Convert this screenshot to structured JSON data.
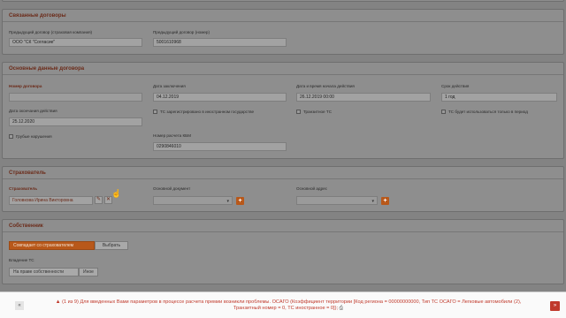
{
  "related": {
    "title": "Связанные договоры",
    "prev_insurer_label": "Предыдущий договор (страховая компания)",
    "prev_insurer_value": "ООО \"СК \"Согласие\"",
    "prev_number_label": "Предыдущий договор (номер)",
    "prev_number_value": "5001610968"
  },
  "main": {
    "title": "Основные данные договора",
    "contract_number_label": "Номер договора",
    "contract_number_value": "",
    "conclusion_date_label": "Дата заключения",
    "conclusion_date_value": "04.12.2019",
    "start_label": "Дата и время начала действия",
    "start_value": "26.12.2019 00:00",
    "term_label": "Срок действия",
    "term_value": "1 год",
    "end_label": "Дата окончания действия",
    "end_value": "25.12.2020",
    "foreign_reg_label": "ТС зарегистрировано в иностранном государстве",
    "transit_label": "Транзитное ТС",
    "period_use_label": "ТС будет использоваться только в период",
    "violations_label": "Грубые нарушения",
    "kbm_label": "Номер расчета КБМ",
    "kbm_value": "0290846010"
  },
  "insurer": {
    "title": "Страхователь",
    "label": "Страхователь",
    "name_value": "Головкова Ирина Викторовна",
    "doc_label": "Основной документ",
    "address_label": "Основной адрес"
  },
  "owner": {
    "title": "Собственник",
    "btn_same": "Совпадает со страхователем",
    "btn_choose": "Выбрать",
    "possession_label": "Владение ТС",
    "possession_value": "На праве собственности",
    "other_label": "Иное"
  },
  "bottom": {
    "message_line1": "(1 из 9) Для введенных Вами параметров в процессе расчета премии возникли проблемы. ОСАГО (Коэффициент территории [Код региона = 00000000000, Тип ТС ОСАГО = Легковые автомобили (2),",
    "message_line2": "Транзитный номер = 0, ТС иностранное = 0]);"
  }
}
